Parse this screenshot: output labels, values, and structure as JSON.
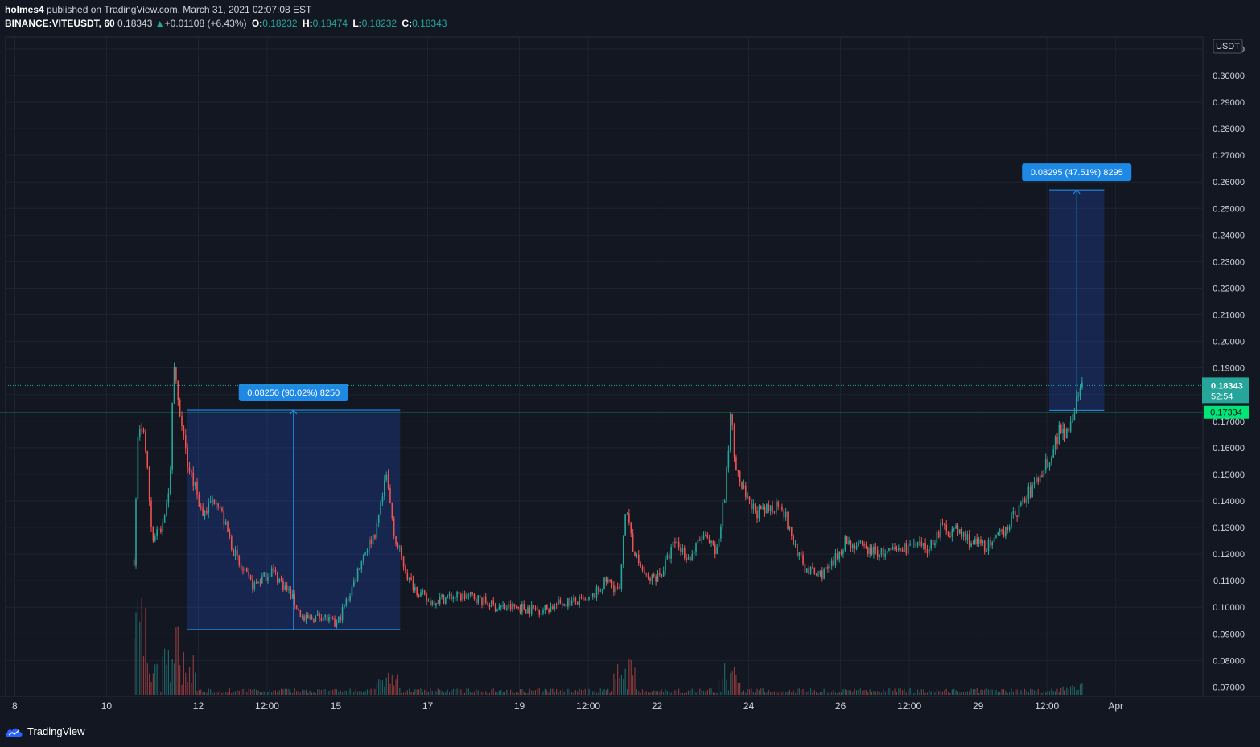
{
  "header": {
    "author": "holmes4",
    "published_text": "published on TradingView.com, March 31, 2021 02:07:08 EST",
    "symbol": "BINANCE:VITEUSDT, 60",
    "last_price": "0.18343",
    "change_arrow": "▲",
    "change": "+0.01108 (+6.43%)",
    "open_label": "O:",
    "open": "0.18232",
    "high_label": "H:",
    "high": "0.18474",
    "low_label": "L:",
    "low": "0.18232",
    "close_label": "C:",
    "close": "0.18343"
  },
  "footer": {
    "brand": "TradingView"
  },
  "colors": {
    "background": "#131722",
    "grid": "#1f2330",
    "up": "#26a69a",
    "down": "#ef5350",
    "horizontal_line": "#00e676",
    "measure_box": "#2962ff",
    "measure_label": "#1e88e5"
  },
  "chart_data": {
    "type": "candlestick",
    "currency_label": "USDT",
    "y_axis_ticks": [
      "0.31000",
      "0.30000",
      "0.29000",
      "0.28000",
      "0.27000",
      "0.26000",
      "0.25000",
      "0.24000",
      "0.23000",
      "0.22000",
      "0.21000",
      "0.20000",
      "0.19000",
      "0.18000",
      "0.17000",
      "0.16000",
      "0.15000",
      "0.14000",
      "0.13000",
      "0.12000",
      "0.11000",
      "0.10000",
      "0.09000",
      "0.08000",
      "0.07000"
    ],
    "ylim": [
      0.0665,
      0.3145
    ],
    "x_axis_ticks": [
      "8",
      "10",
      "12",
      "12:00",
      "15",
      "17",
      "19",
      "12:00",
      "22",
      "24",
      "26",
      "12:00",
      "29",
      "12:00",
      "Apr"
    ],
    "x_tick_days": [
      8,
      10,
      12,
      13.5,
      15,
      17,
      19,
      20.5,
      22,
      24,
      26,
      27.5,
      29,
      30.5,
      32
    ],
    "xlim": [
      7.8,
      33.9
    ],
    "price_path": [
      [
        10.6,
        0.118
      ],
      [
        10.7,
        0.172
      ],
      [
        10.85,
        0.16
      ],
      [
        11.0,
        0.125
      ],
      [
        11.2,
        0.13
      ],
      [
        11.4,
        0.15
      ],
      [
        11.45,
        0.195
      ],
      [
        11.55,
        0.176
      ],
      [
        11.75,
        0.155
      ],
      [
        12.1,
        0.135
      ],
      [
        12.4,
        0.142
      ],
      [
        12.6,
        0.13
      ],
      [
        12.9,
        0.115
      ],
      [
        13.2,
        0.108
      ],
      [
        13.6,
        0.114
      ],
      [
        14.0,
        0.105
      ],
      [
        14.3,
        0.095
      ],
      [
        14.7,
        0.097
      ],
      [
        15.0,
        0.093
      ],
      [
        15.3,
        0.105
      ],
      [
        15.6,
        0.12
      ],
      [
        15.9,
        0.13
      ],
      [
        16.1,
        0.149
      ],
      [
        16.3,
        0.125
      ],
      [
        16.6,
        0.11
      ],
      [
        17.0,
        0.102
      ],
      [
        17.5,
        0.104
      ],
      [
        18.0,
        0.104
      ],
      [
        18.5,
        0.1
      ],
      [
        19.0,
        0.1
      ],
      [
        19.5,
        0.099
      ],
      [
        20.0,
        0.102
      ],
      [
        20.5,
        0.102
      ],
      [
        20.9,
        0.11
      ],
      [
        21.2,
        0.106
      ],
      [
        21.3,
        0.138
      ],
      [
        21.5,
        0.12
      ],
      [
        21.8,
        0.11
      ],
      [
        22.1,
        0.113
      ],
      [
        22.4,
        0.125
      ],
      [
        22.7,
        0.118
      ],
      [
        23.0,
        0.127
      ],
      [
        23.3,
        0.12
      ],
      [
        23.5,
        0.145
      ],
      [
        23.6,
        0.172
      ],
      [
        23.75,
        0.15
      ],
      [
        24.0,
        0.138
      ],
      [
        24.3,
        0.135
      ],
      [
        24.7,
        0.14
      ],
      [
        24.9,
        0.128
      ],
      [
        25.2,
        0.115
      ],
      [
        25.5,
        0.112
      ],
      [
        25.8,
        0.115
      ],
      [
        26.1,
        0.125
      ],
      [
        26.5,
        0.122
      ],
      [
        27.0,
        0.12
      ],
      [
        27.5,
        0.123
      ],
      [
        27.9,
        0.122
      ],
      [
        28.2,
        0.13
      ],
      [
        28.6,
        0.128
      ],
      [
        28.9,
        0.124
      ],
      [
        29.3,
        0.123
      ],
      [
        29.6,
        0.13
      ],
      [
        30.0,
        0.14
      ],
      [
        30.3,
        0.148
      ],
      [
        30.6,
        0.158
      ],
      [
        30.8,
        0.168
      ],
      [
        30.95,
        0.165
      ],
      [
        31.1,
        0.175
      ],
      [
        31.3,
        0.183
      ]
    ],
    "volume_spikes": [
      {
        "day": 10.6,
        "scale": 0.85
      },
      {
        "day": 10.85,
        "scale": 0.6
      },
      {
        "day": 11.45,
        "scale": 0.5
      },
      {
        "day": 11.7,
        "scale": 0.45
      },
      {
        "day": 16.1,
        "scale": 0.2
      },
      {
        "day": 21.3,
        "scale": 0.35
      },
      {
        "day": 23.6,
        "scale": 0.3
      },
      {
        "day": 31.05,
        "scale": 0.08
      }
    ],
    "horizontal_line": {
      "price": 0.17334,
      "label": "0.17334"
    },
    "last_price_label": "0.18343",
    "countdown_label": "52:54",
    "measures": [
      {
        "day_from": 11.75,
        "day_to": 16.4,
        "price_from": 0.09165,
        "price_to": 0.17415,
        "label": "0.08250 (90.02%) 8250"
      },
      {
        "day_from": 30.55,
        "day_to": 31.75,
        "price_from": 0.17405,
        "price_to": 0.257,
        "label": "0.08295 (47.51%) 8295"
      }
    ]
  }
}
